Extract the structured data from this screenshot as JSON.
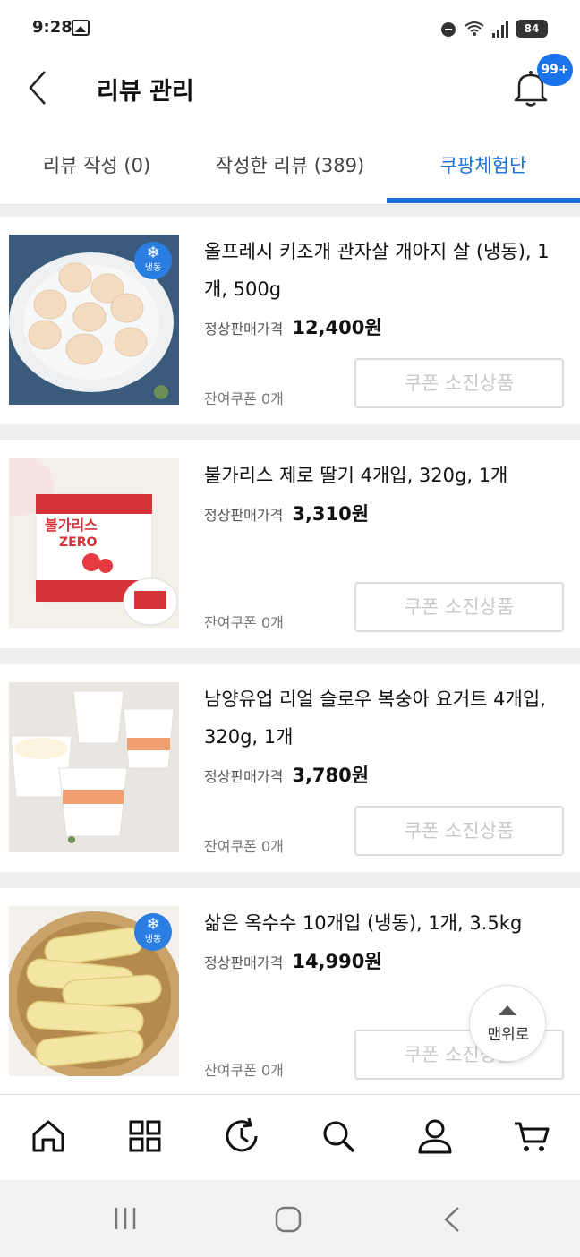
{
  "status_bar": {
    "time": "9:28",
    "battery": "84"
  },
  "header": {
    "title": "리뷰 관리",
    "notification_badge": "99+"
  },
  "tabs": [
    {
      "label": "리뷰 작성 (0)",
      "active": false
    },
    {
      "label": "작성한 리뷰 (389)",
      "active": false
    },
    {
      "label": "쿠팡체험단",
      "active": true
    }
  ],
  "products": [
    {
      "name": "올프레시 키조개 관자살 개아지 살 (냉동), 1개, 500g",
      "price_label": "정상판매가격",
      "price": "12,400원",
      "remaining": "잔여쿠폰 0개",
      "coupon_button": "쿠폰 소진상품",
      "frozen": true,
      "frozen_label": "냉동"
    },
    {
      "name": "불가리스 제로 딸기 4개입, 320g, 1개",
      "price_label": "정상판매가격",
      "price": "3,310원",
      "remaining": "잔여쿠폰 0개",
      "coupon_button": "쿠폰 소진상품",
      "frozen": false
    },
    {
      "name": "남양유업 리얼 슬로우 복숭아 요거트 4개입, 320g, 1개",
      "price_label": "정상판매가격",
      "price": "3,780원",
      "remaining": "잔여쿠폰 0개",
      "coupon_button": "쿠폰 소진상품",
      "frozen": false
    },
    {
      "name": "삶은 옥수수 10개입 (냉동), 1개, 3.5kg",
      "price_label": "정상판매가격",
      "price": "14,990원",
      "remaining": "잔여쿠폰 0개",
      "coupon_button": "쿠폰 소진상품",
      "frozen": true,
      "frozen_label": "냉동"
    }
  ],
  "scroll_top_button": "맨위로",
  "colors": {
    "accent": "#1b6fd9",
    "badge": "#1a73e8",
    "frozen_badge": "#2a7de1"
  }
}
